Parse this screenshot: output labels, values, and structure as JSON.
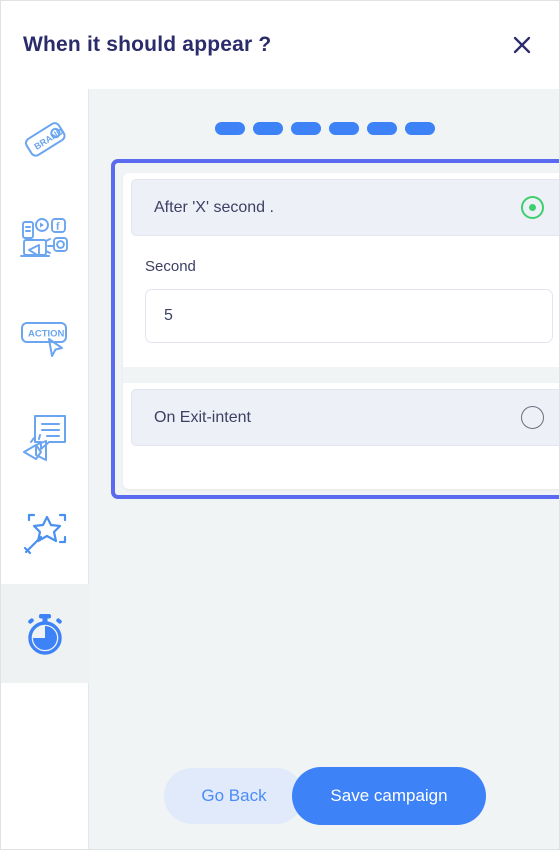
{
  "header": {
    "title": "When it should appear ?",
    "close_icon": "close-icon"
  },
  "sidebar": {
    "items": [
      {
        "icon": "brand-tag-icon",
        "name": "brand",
        "active": false
      },
      {
        "icon": "social-media-icon",
        "name": "channels",
        "active": false
      },
      {
        "icon": "action-button-icon",
        "name": "action",
        "active": false
      },
      {
        "icon": "megaphone-message-icon",
        "name": "message",
        "active": false
      },
      {
        "icon": "magic-wand-icon",
        "name": "design",
        "active": false
      },
      {
        "icon": "stopwatch-icon",
        "name": "timing",
        "active": true
      }
    ]
  },
  "main": {
    "steps": {
      "total": 6,
      "completed": 6
    },
    "options": [
      {
        "label": "After 'X' second .",
        "selected": true,
        "field": {
          "label": "Second",
          "value": "5",
          "placeholder": "Second"
        }
      },
      {
        "label": "On Exit-intent",
        "selected": false
      }
    ]
  },
  "footer": {
    "back_label": "Go Back",
    "save_label": "Save campaign"
  },
  "colors": {
    "accent_blue": "#3d82f7",
    "highlight_border": "#5a6bf0",
    "radio_selected_green": "#3ecf6d",
    "title_navy": "#2b2c6b",
    "content_bg": "#f1f4f5"
  }
}
